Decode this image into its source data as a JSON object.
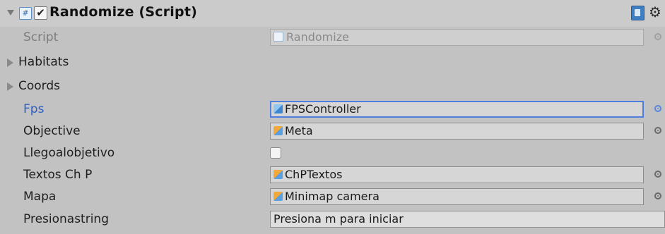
{
  "component": {
    "title": "Randomize (Script)",
    "enabled": true,
    "enabled_glyph": "✔",
    "script_icon_glyph": "#",
    "gear_glyph": "⚙"
  },
  "rows": {
    "script": {
      "label": "Script",
      "value": "Randomize"
    },
    "habitats": {
      "label": "Habitats"
    },
    "coords": {
      "label": "Coords"
    },
    "fps": {
      "label": "Fps",
      "value": "FPSController"
    },
    "objective": {
      "label": "Objective",
      "value": "Meta"
    },
    "llegoalobjetivo": {
      "label": "Llegoalobjetivo",
      "checked": false
    },
    "textos": {
      "label": "Textos Ch P",
      "value": "ChPTextos"
    },
    "mapa": {
      "label": "Mapa",
      "value": "Minimap camera"
    },
    "presionastring": {
      "label": "Presionastring",
      "value": "Presiona m para iniciar"
    }
  },
  "icons": {
    "foldout": "triangle-down-icon",
    "help": "help-book-icon",
    "settings": "gear-icon",
    "object_picker": "object-picker-icon",
    "gameobject": "gameobject-cube-icon"
  },
  "colors": {
    "background": "#c2c2c2",
    "selected_label": "#2e5fc5",
    "focus_border": "#4f7ee0"
  }
}
